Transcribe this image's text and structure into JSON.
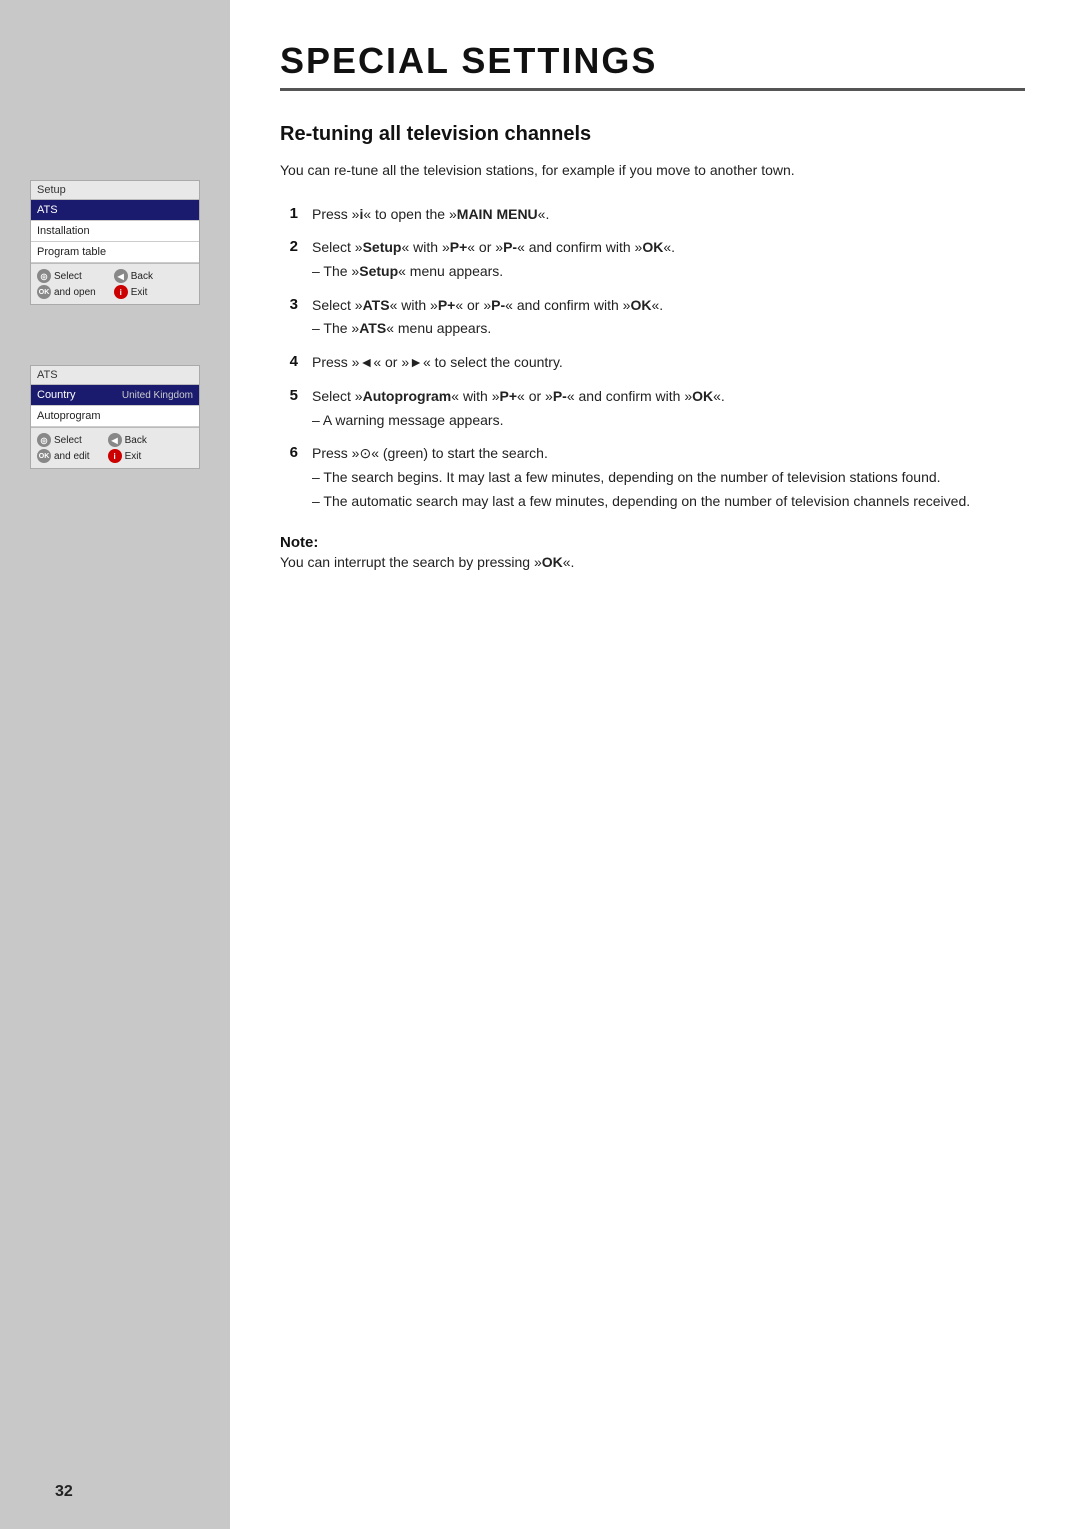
{
  "page": {
    "number": "32",
    "title": "SPECIAL SETTINGS"
  },
  "section": {
    "heading": "Re-tuning all television channels",
    "intro": "You can re-tune all the television stations, for example if you move to another town."
  },
  "steps": [
    {
      "number": "1",
      "text": "Press »i« to open the »MAIN MENU«."
    },
    {
      "number": "2",
      "text": "Select »Setup« with »P+« or »P-« and confirm with »OK«.",
      "sub": "– The »Setup« menu appears."
    },
    {
      "number": "3",
      "text": "Select »ATS« with »P+« or »P-« and confirm with »OK«.",
      "sub": "– The »ATS« menu appears."
    },
    {
      "number": "4",
      "text": "Press »◄« or »►« to select the country."
    },
    {
      "number": "5",
      "text": "Select »Autoprogram« with »P+« or »P-« and confirm with »OK«.",
      "sub": "– A warning message appears."
    },
    {
      "number": "6",
      "text": "Press »⊙« (green) to start the search.",
      "subs": [
        "– The search begins. It may last a few minutes, depending on the number of television stations found.",
        "– The automatic search may last a few minutes, depending on the number of television channels received."
      ]
    }
  ],
  "note": {
    "label": "Note:",
    "text": "You can interrupt the search by pressing »OK«."
  },
  "menu1": {
    "header": "Setup",
    "items": [
      {
        "label": "ATS",
        "selected": true
      },
      {
        "label": "Installation",
        "selected": false
      },
      {
        "label": "Program table",
        "selected": false
      }
    ],
    "footer": {
      "col1": [
        {
          "icon": "gray",
          "label": "Select"
        },
        {
          "icon": "ok",
          "label": "and open"
        }
      ],
      "col2": [
        {
          "icon": "gray",
          "label": "Back"
        },
        {
          "icon": "red",
          "label": "Exit"
        }
      ]
    }
  },
  "menu2": {
    "header": "ATS",
    "items": [
      {
        "label": "Country",
        "value": "United Kingdom",
        "selected": true
      },
      {
        "label": "Autoprogram",
        "value": "",
        "selected": false
      }
    ],
    "footer": {
      "col1": [
        {
          "icon": "gray",
          "label": "Select"
        },
        {
          "icon": "ok",
          "label": "and edit"
        }
      ],
      "col2": [
        {
          "icon": "gray",
          "label": "Back"
        },
        {
          "icon": "red",
          "label": "Exit"
        }
      ]
    }
  }
}
